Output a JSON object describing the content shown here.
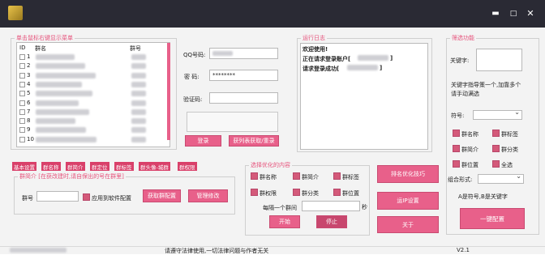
{
  "window": {
    "minimize_glyph": "▬",
    "maximize_glyph": "□",
    "close_glyph": "✕"
  },
  "group_list": {
    "legend": "单击鼠标右键显示菜单",
    "columns": [
      "ID",
      "群名",
      "群号"
    ],
    "row_ids": [
      "1",
      "2",
      "3",
      "4",
      "5",
      "6",
      "7",
      "8",
      "9",
      "10"
    ]
  },
  "login": {
    "qq_label": "QQ号码:",
    "password_label": "密 码:",
    "password_value": "********",
    "captcha_label": "验证码:",
    "login_button": "登录",
    "fetch_button": "获列表获取/重录"
  },
  "log": {
    "legend": "运行日志",
    "lines": [
      "欢迎使用!",
      "正在请求登录账户[",
      "请求登录成功["
    ]
  },
  "filter": {
    "legend": "筛选功能",
    "keyword_label": "关键字:",
    "keyword_hint": "关键字指导策一个,加靠多个请手动满选",
    "symbol_label": "符号:",
    "options": [
      "群名称",
      "群标签",
      "群简介",
      "群分类",
      "群位置",
      "全选"
    ],
    "combo_label": "组合形式:",
    "combo_hint": "A是符号,B是关键字",
    "apply_button": "一键配置"
  },
  "tabs": [
    "基本设置",
    "群名称",
    "群简介",
    "群定位",
    "群标签",
    "群头像-城群",
    "群权限"
  ],
  "group_intro": {
    "legend": "群简介 [在获改建时,请自保出的号在群里]",
    "group_no_label": "群号",
    "apply_checkbox": "应用到软件配置",
    "fetch_button": "获取群配置",
    "set_button": "管理修改"
  },
  "optimize": {
    "legend": "选择优化的内容",
    "options": [
      "群名称",
      "群简介",
      "群标签",
      "群权限",
      "群分类",
      "群位置"
    ],
    "interval_label": "每隔一个群间",
    "interval_unit": "秒",
    "start_button": "开始",
    "stop_button": "停止"
  },
  "right_buttons": [
    "排名优化技巧",
    "运IP设置",
    "关于"
  ],
  "status": {
    "text": "请遵守法律使用,一切法律问题与作者无关",
    "version": "V2.1"
  },
  "colors": {
    "accent": "#e8608a",
    "title_bar": "#2a2a34",
    "legend": "#e6527b"
  }
}
